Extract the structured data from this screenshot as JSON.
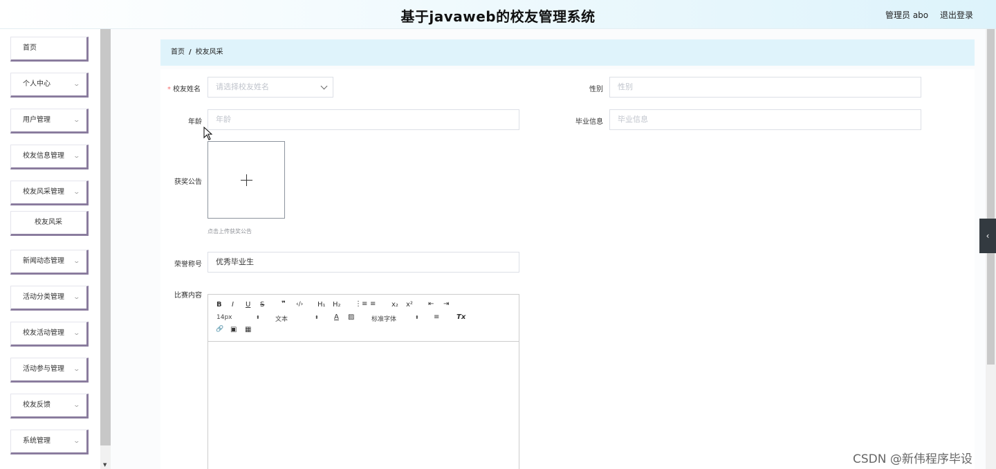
{
  "header": {
    "title": "基于javaweb的校友管理系统",
    "user": "管理员 abo",
    "logout": "退出登录"
  },
  "sidebar": {
    "items": [
      {
        "label": "首页",
        "arrow": false
      },
      {
        "label": "个人中心",
        "arrow": true
      },
      {
        "label": "用户管理",
        "arrow": true
      },
      {
        "label": "校友信息管理",
        "arrow": true
      },
      {
        "label": "校友风采管理",
        "arrow": true
      },
      {
        "label": "校友风采",
        "arrow": false,
        "sub": true
      },
      {
        "label": "新闻动态管理",
        "arrow": true
      },
      {
        "label": "活动分类管理",
        "arrow": true
      },
      {
        "label": "校友活动管理",
        "arrow": true
      },
      {
        "label": "活动参与管理",
        "arrow": true
      },
      {
        "label": "校友反馈",
        "arrow": true
      },
      {
        "label": "系统管理",
        "arrow": true
      }
    ]
  },
  "breadcrumb": {
    "home": "首页",
    "separator": "/",
    "current": "校友风采"
  },
  "form": {
    "alumni_name": {
      "label": "校友姓名",
      "placeholder": "请选择校友姓名",
      "required": "*"
    },
    "gender": {
      "label": "性别",
      "placeholder": "性别"
    },
    "age": {
      "label": "年龄",
      "placeholder": "年龄"
    },
    "graduation": {
      "label": "毕业信息",
      "placeholder": "毕业信息"
    },
    "award": {
      "label": "获奖公告",
      "tip": "点击上传获奖公告"
    },
    "honor": {
      "label": "荣誉称号",
      "value": "优秀毕业生"
    },
    "contest": {
      "label": "比赛内容"
    }
  },
  "editor": {
    "font_size": "14px",
    "text_style": "文本",
    "font_family": "标准字体",
    "bold": "B",
    "italic": "I",
    "underline": "U",
    "strike": "S",
    "quote": "❞",
    "code": "‹/›",
    "h1": "H₁",
    "h2": "H₂",
    "ordered_list": "⋮≡",
    "bullet_list": "≡",
    "subscript": "x₂",
    "superscript": "x²",
    "outdent": "⇤",
    "indent": "⇥",
    "font_color": "A",
    "background": "▨",
    "align": "≡",
    "clean": "Tx",
    "link": "🔗",
    "image": "▣",
    "video": "▦"
  },
  "watermark": "CSDN @新伟程序毕设",
  "colors": {
    "breadcrumb_bg": "#dff3fb",
    "menu_border": "#8a7c9e",
    "required": "#f56c6c"
  }
}
